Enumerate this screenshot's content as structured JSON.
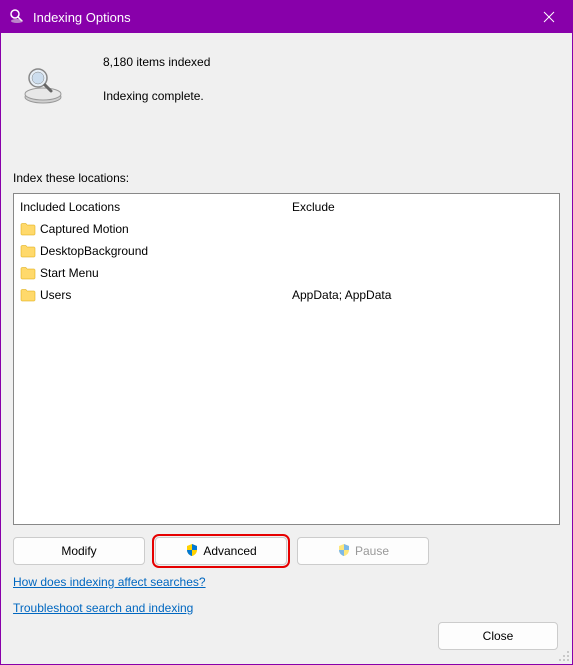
{
  "window": {
    "title": "Indexing Options"
  },
  "status": {
    "items_indexed": "8,180 items indexed",
    "state": "Indexing complete."
  },
  "section_label": "Index these locations:",
  "columns": {
    "included": "Included Locations",
    "exclude": "Exclude"
  },
  "locations": [
    {
      "name": "Captured Motion",
      "exclude": ""
    },
    {
      "name": "DesktopBackground",
      "exclude": ""
    },
    {
      "name": "Start Menu",
      "exclude": ""
    },
    {
      "name": "Users",
      "exclude": "AppData; AppData"
    }
  ],
  "buttons": {
    "modify": "Modify",
    "advanced": "Advanced",
    "pause": "Pause",
    "close": "Close"
  },
  "links": {
    "how": "How does indexing affect searches?",
    "troubleshoot": "Troubleshoot search and indexing"
  }
}
